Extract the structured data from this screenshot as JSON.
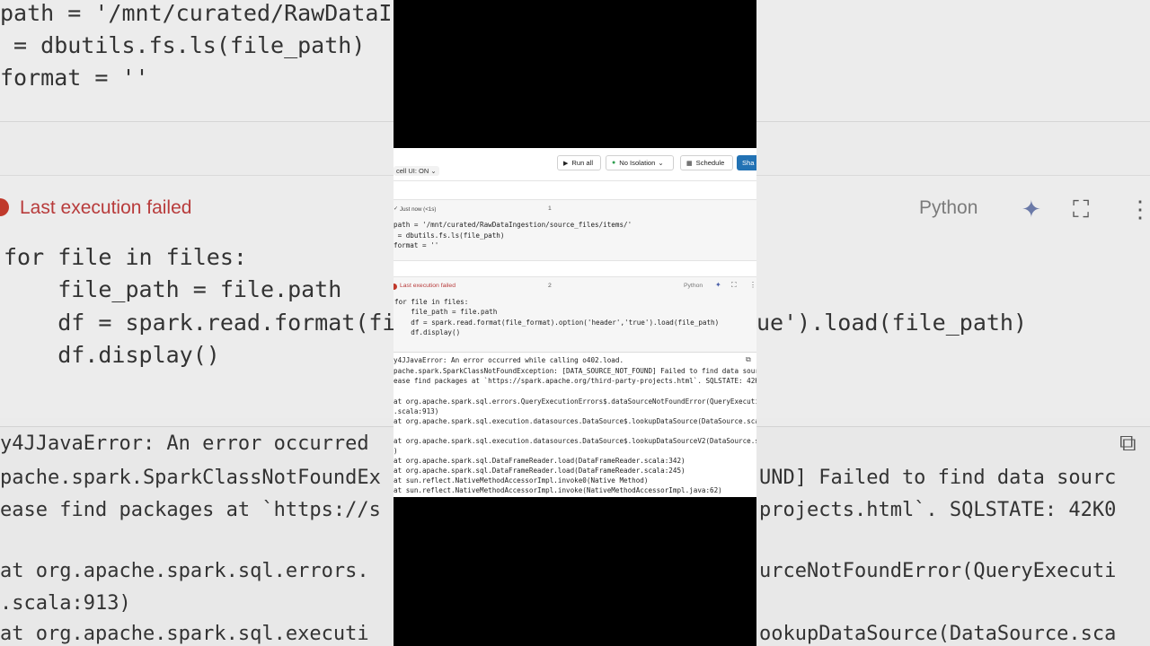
{
  "background": {
    "code1": [
      "path = '/mnt/curated/RawDataIng",
      " = dbutils.fs.ls(file_path)",
      "format = ''"
    ],
    "status": "Last execution failed",
    "language": "Python",
    "code2": [
      "for file in files:",
      "    file_path = file.path",
      "    df = spark.read.format(file",
      "    df.display()"
    ],
    "code2_right": "ue').load(file_path)",
    "output_left": [
      "y4JJavaError: An error occurred",
      "pache.spark.SparkClassNotFoundEx",
      "ease find packages at `https://s",
      "",
      "at org.apache.spark.sql.errors.",
      ".scala:913)",
      "at org.apache.spark.sql.executi"
    ],
    "output_right": [
      "UND] Failed to find data sourc",
      "projects.html`. SQLSTATE: 42K0",
      "",
      "",
      "urceNotFoundError(QueryExecuti",
      "",
      "ookupDataSource(DataSource.sca"
    ]
  },
  "toolbar": {
    "cell_ui": "cell UI: ON",
    "run_all": "Run all",
    "isolation": "No Isolation",
    "schedule": "Schedule",
    "share": "Sha"
  },
  "cell1": {
    "meta": "Just now (<1s)",
    "number": "1",
    "code": [
      "path = '/mnt/curated/RawDataIngestion/source_files/items/'",
      " = dbutils.fs.ls(file_path)",
      "format = ''"
    ]
  },
  "cell2": {
    "status": "Last execution failed",
    "number": "2",
    "language": "Python",
    "code": [
      "for file in files:",
      "    file_path = file.path",
      "    df = spark.read.format(file_format).option('header','true').load(file_path)",
      "    df.display()"
    ]
  },
  "output": {
    "lines": [
      "y4JJavaError: An error occurred while calling o402.load.",
      "pache.spark.SparkClassNotFoundException: [DATA_SOURCE_NOT_FOUND] Failed to find data sourc",
      "ease find packages at `https://spark.apache.org/third-party-projects.html`. SQLSTATE: 42K0",
      "",
      "at org.apache.spark.sql.errors.QueryExecutionErrors$.dataSourceNotFoundError(QueryExecuti",
      ".scala:913)",
      "at org.apache.spark.sql.execution.datasources.DataSource$.lookupDataSource(DataSource.sca",
      "",
      "at org.apache.spark.sql.execution.datasources.DataSource$.lookupDataSourceV2(DataSource.s",
      ")",
      "at org.apache.spark.sql.DataFrameReader.load(DataFrameReader.scala:342)",
      "at org.apache.spark.sql.DataFrameReader.load(DataFrameReader.scala:245)",
      "at sun.reflect.NativeMethodAccessorImpl.invoke0(Native Method)",
      "at sun.reflect.NativeMethodAccessorImpl.invoke(NativeMethodAccessorImpl.java:62)"
    ]
  },
  "colors": {
    "error": "#b83b3b",
    "share_button": "#2272b4",
    "isolation_dot": "#2e9e4f"
  }
}
